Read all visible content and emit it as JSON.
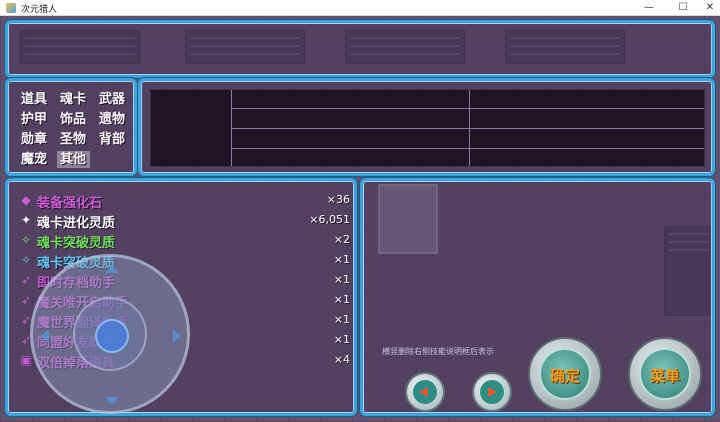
{
  "window": {
    "title": "次元猎人",
    "minimize": "—",
    "maximize": "☐",
    "close": "✕"
  },
  "categories": [
    {
      "label": "道具",
      "selected": false
    },
    {
      "label": "魂卡",
      "selected": false
    },
    {
      "label": "武器",
      "selected": false
    },
    {
      "label": "护甲",
      "selected": false
    },
    {
      "label": "饰品",
      "selected": false
    },
    {
      "label": "遗物",
      "selected": false
    },
    {
      "label": "勋章",
      "selected": false
    },
    {
      "label": "圣物",
      "selected": false
    },
    {
      "label": "背部",
      "selected": false
    },
    {
      "label": "魔宠",
      "selected": false
    },
    {
      "label": "其他",
      "selected": true
    }
  ],
  "items": [
    {
      "name": "装备强化石",
      "count": "×36",
      "color": "#d05cd6",
      "icon": "gem-icon",
      "glyph": "◆"
    },
    {
      "name": "魂卡进化灵质",
      "count": "×6,051",
      "color": "#ffffff",
      "icon": "crystal-icon",
      "glyph": "✦"
    },
    {
      "name": "魂卡突破灵质",
      "count": "×2",
      "color": "#6ee25a",
      "icon": "crystal-cluster-icon",
      "glyph": "✧"
    },
    {
      "name": "魂卡突破灵质",
      "count": "×1",
      "color": "#5fc8ee",
      "icon": "crystal-cluster-icon",
      "glyph": "✧"
    },
    {
      "name": "即时存档助手",
      "count": "×1",
      "color": "#c85ad2",
      "icon": "runner-icon",
      "glyph": "➶"
    },
    {
      "name": "魔关唯开启助手",
      "count": "×1",
      "color": "#c85ad2",
      "icon": "runner-icon",
      "glyph": "➶"
    },
    {
      "name": "魔世界翻译助手",
      "count": "×1",
      "color": "#c85ad2",
      "icon": "runner-icon",
      "glyph": "➶"
    },
    {
      "name": "同盟好友助手",
      "count": "×1",
      "color": "#c85ad2",
      "icon": "runner-icon",
      "glyph": "➶"
    },
    {
      "name": "双倍掉落道具",
      "count": "×4",
      "color": "#c85ad2",
      "icon": "ticket-icon",
      "glyph": "▣"
    }
  ],
  "buttons": {
    "confirm": "确定",
    "menu": "菜单"
  },
  "hint": "横竖删除右侧技能说明框后表示"
}
